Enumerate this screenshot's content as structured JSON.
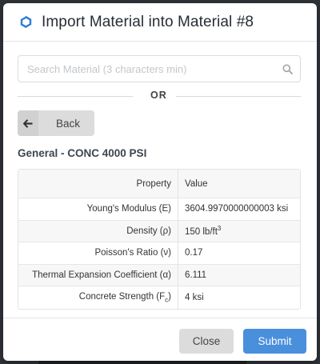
{
  "modal": {
    "title": "Import Material into Material #8",
    "icon": "sync-logo-icon",
    "accent_color": "#2f7bd8"
  },
  "search": {
    "placeholder": "Search Material (3 characters min)",
    "value": ""
  },
  "divider": {
    "text": "OR"
  },
  "back_button": {
    "label": "Back"
  },
  "section": {
    "title": "General - CONC 4000 PSI"
  },
  "table": {
    "headers": {
      "property": "Property",
      "value": "Value"
    },
    "rows": [
      {
        "property": "Young's Modulus (E)",
        "value": "3604.9970000000003 ksi"
      },
      {
        "property": "Density (ρ)",
        "value": "150 lb/ft",
        "value_sup": "3"
      },
      {
        "property": "Poisson's Ratio (ν)",
        "value": "0.17"
      },
      {
        "property": "Thermal Expansion Coefficient (α)",
        "value": "6.111"
      },
      {
        "property": "Concrete Strength (F",
        "property_sub": "c",
        "property_suffix": ")",
        "value": "4 ksi"
      }
    ]
  },
  "footer": {
    "close_label": "Close",
    "submit_label": "Submit",
    "submit_color": "#4a8fdc"
  }
}
